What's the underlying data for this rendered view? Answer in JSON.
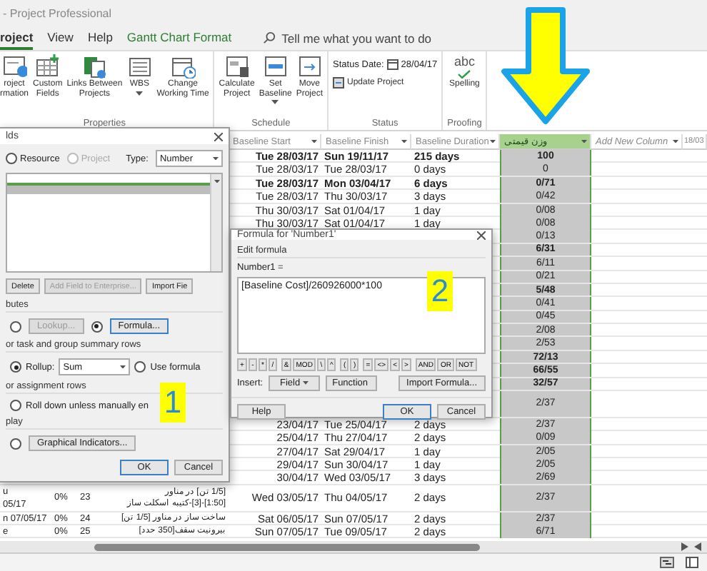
{
  "window": {
    "title": "- Project Professional"
  },
  "ribbon_tabs": [
    {
      "label": "roject",
      "selected": true,
      "kind": "normal"
    },
    {
      "label": "View",
      "selected": false,
      "kind": "normal"
    },
    {
      "label": "Help",
      "selected": false,
      "kind": "normal"
    },
    {
      "label": "Gantt Chart Format",
      "selected": false,
      "kind": "contextual"
    }
  ],
  "search": {
    "placeholder": "Tell me what you want to do"
  },
  "ribbon_groups": [
    {
      "label": "Properties",
      "commands": [
        {
          "kind": "large",
          "label": "roject\nrmation"
        },
        {
          "kind": "large",
          "label": "Custom\nFields"
        },
        {
          "kind": "large",
          "label": "Links Between\nProjects"
        },
        {
          "kind": "large",
          "label": "WBS",
          "has_menu": true
        },
        {
          "kind": "large",
          "label": "Change\nWorking Time"
        }
      ]
    },
    {
      "label": "Schedule",
      "commands": [
        {
          "kind": "large",
          "label": "Calculate\nProject"
        },
        {
          "kind": "large",
          "label": "Set\nBaseline",
          "has_menu": true
        },
        {
          "kind": "large",
          "label": "Move\nProject"
        }
      ]
    },
    {
      "label": "Status",
      "commands": [
        {
          "kind": "date",
          "label": "Status Date:",
          "value": "28/04/17"
        },
        {
          "kind": "small",
          "label": "Update Project"
        }
      ]
    },
    {
      "label": "Proofing",
      "commands": [
        {
          "kind": "spelling",
          "label": "Spelling",
          "glyph": "abc"
        }
      ]
    }
  ],
  "table": {
    "columns": [
      {
        "label": "Baseline Start",
        "selected": false
      },
      {
        "label": "Baseline Finish",
        "selected": false
      },
      {
        "label": "Baseline Duration",
        "selected": false
      },
      {
        "label": "وزن قیمتی",
        "selected": true
      },
      {
        "label": "Add New Column",
        "selected": false,
        "kind": "new"
      },
      {
        "label": "18/03",
        "selected": false
      }
    ],
    "rows": [
      {
        "summary": true,
        "two_line": false,
        "start": "Tue 28/03/17",
        "finish": "Sun 19/11/17",
        "duration": "215 days",
        "value": "100"
      },
      {
        "summary": false,
        "two_line": false,
        "start": "Tue 28/03/17",
        "finish": "Tue 28/03/17",
        "duration": "0 days",
        "value": "0"
      },
      {
        "summary": true,
        "two_line": false,
        "start": "Tue 28/03/17",
        "finish": "Mon 03/04/17",
        "duration": "6 days",
        "value": "0/71"
      },
      {
        "summary": false,
        "two_line": false,
        "start": "Tue 28/03/17",
        "finish": "Thu 30/03/17",
        "duration": "3 days",
        "value": "0/42"
      },
      {
        "summary": false,
        "two_line": false,
        "start": "Thu 30/03/17",
        "finish": "Sat 01/04/17",
        "duration": "1 day",
        "value": "0/08"
      },
      {
        "summary": false,
        "two_line": false,
        "start": "Thu 30/03/17",
        "finish": "Sat 01/04/17",
        "duration": "1 day",
        "value": "0/08"
      },
      {
        "summary": false,
        "two_line": false,
        "value": "0/13"
      },
      {
        "summary": true,
        "two_line": false,
        "value": "6/31"
      },
      {
        "summary": false,
        "two_line": false,
        "value": "6/11"
      },
      {
        "summary": false,
        "two_line": false,
        "value": "0/21"
      },
      {
        "summary": true,
        "two_line": false,
        "value": "5/48"
      },
      {
        "summary": false,
        "two_line": false,
        "value": "0/41"
      },
      {
        "summary": false,
        "two_line": false,
        "value": "0/45"
      },
      {
        "summary": false,
        "two_line": false,
        "value": "2/08"
      },
      {
        "summary": false,
        "two_line": false,
        "value": "2/53"
      },
      {
        "summary": true,
        "two_line": false,
        "value": "72/13"
      },
      {
        "summary": true,
        "two_line": false,
        "value": "66/55"
      },
      {
        "summary": true,
        "two_line": false,
        "value": "32/57"
      },
      {
        "summary": false,
        "two_line": true,
        "value": "2/37"
      },
      {
        "summary": false,
        "two_line": false,
        "start": "23/04/17",
        "finish": "Tue 25/04/17",
        "duration": "2 days",
        "value": "2/37"
      },
      {
        "summary": false,
        "two_line": false,
        "start": "25/04/17",
        "finish": "Thu 27/04/17",
        "duration": "2 days",
        "value": "0/09"
      },
      {
        "summary": false,
        "two_line": false,
        "start": "27/04/17",
        "finish": "Sat 29/04/17",
        "duration": "1 day",
        "value": "2/05"
      },
      {
        "summary": false,
        "two_line": false,
        "start": "29/04/17",
        "finish": "Sun 30/04/17",
        "duration": "1 day",
        "value": "2/05"
      },
      {
        "summary": false,
        "two_line": false,
        "start": "30/04/17",
        "finish": "Wed 03/05/17",
        "duration": "3 days",
        "value": "2/69"
      },
      {
        "summary": false,
        "two_line": true,
        "col_1": "u\n05/17",
        "col_2": "0%",
        "col_3": "23",
        "col_4": "[1/5 تن] در مناور\n[1:50]-[3]-کتیبه اسکلت ساز",
        "start": "Wed 03/05/17",
        "finish": "Thu 04/05/17",
        "duration": "2 days",
        "value": "2/37"
      },
      {
        "summary": false,
        "two_line": false,
        "col_1": "n 07/05/17",
        "col_2": "0%",
        "col_3": "24",
        "col_4": "ساخت ساز در مناور [1/5 تن]",
        "start": "Sat 06/05/17",
        "finish": "Sun 07/05/17",
        "duration": "2 days",
        "value": "2/37"
      },
      {
        "summary": false,
        "two_line": false,
        "col_1": "e",
        "col_2": "0%",
        "col_3": "25",
        "col_4": "بیرونیت سقف[350 حدد]",
        "start": "Sun 07/05/17",
        "finish": "Tue 09/05/17",
        "duration": "2 days",
        "value": "6/71"
      }
    ]
  },
  "custom_fields_dialog": {
    "title": "lds",
    "radios": [
      {
        "label": "Resource",
        "selected": false,
        "disabled": false
      },
      {
        "label": "Project",
        "selected": false,
        "disabled": true
      }
    ],
    "type_label": "Type:",
    "type_value": "Number",
    "buttons": [
      {
        "label": "Delete",
        "disabled": false
      },
      {
        "label": "Add Field to Enterprise...",
        "disabled": true
      },
      {
        "label": "Import Fie",
        "disabled": false
      }
    ],
    "attributes_label": "butes",
    "lookup": {
      "label": "Lookup...",
      "selected": false,
      "disabled": true
    },
    "formula": {
      "label": "Formula...",
      "selected": true
    },
    "summary_label": "or task and group summary rows",
    "rollup": {
      "label": "Rollup:",
      "selected": true,
      "value": "Sum"
    },
    "use_formula": {
      "label": "Use formula",
      "selected": false
    },
    "assignment_label": "or assignment rows",
    "roll_down": {
      "label": "Roll down unless manually en",
      "selected": false
    },
    "display_label": "play",
    "display_radio": {
      "selected": false
    },
    "graphical_indicators": "Graphical Indicators...",
    "footer_buttons": [
      {
        "label": "OK",
        "default": true
      },
      {
        "label": "Cancel",
        "default": false
      }
    ]
  },
  "formula_dialog": {
    "title": "Formula for 'Number1'",
    "section_label": "Edit formula",
    "field_label": "Number1 =",
    "formula": "[Baseline Cost]/260926000*100",
    "operators": [
      "+",
      "-",
      "*",
      "/",
      "&",
      "MOD",
      "\\",
      "^",
      "(",
      ")",
      "=",
      "<>",
      "<",
      ">",
      "AND",
      "OR",
      "NOT"
    ],
    "insert_label": "Insert:",
    "menus": [
      "Field",
      "Function"
    ],
    "import_button": "Import Formula...",
    "footer_buttons": [
      {
        "label": "Help",
        "default": false
      },
      {
        "label": "OK",
        "default": true
      },
      {
        "label": "Cancel",
        "default": false
      }
    ]
  },
  "annotations": [
    {
      "label": "1"
    },
    {
      "label": "2"
    }
  ]
}
